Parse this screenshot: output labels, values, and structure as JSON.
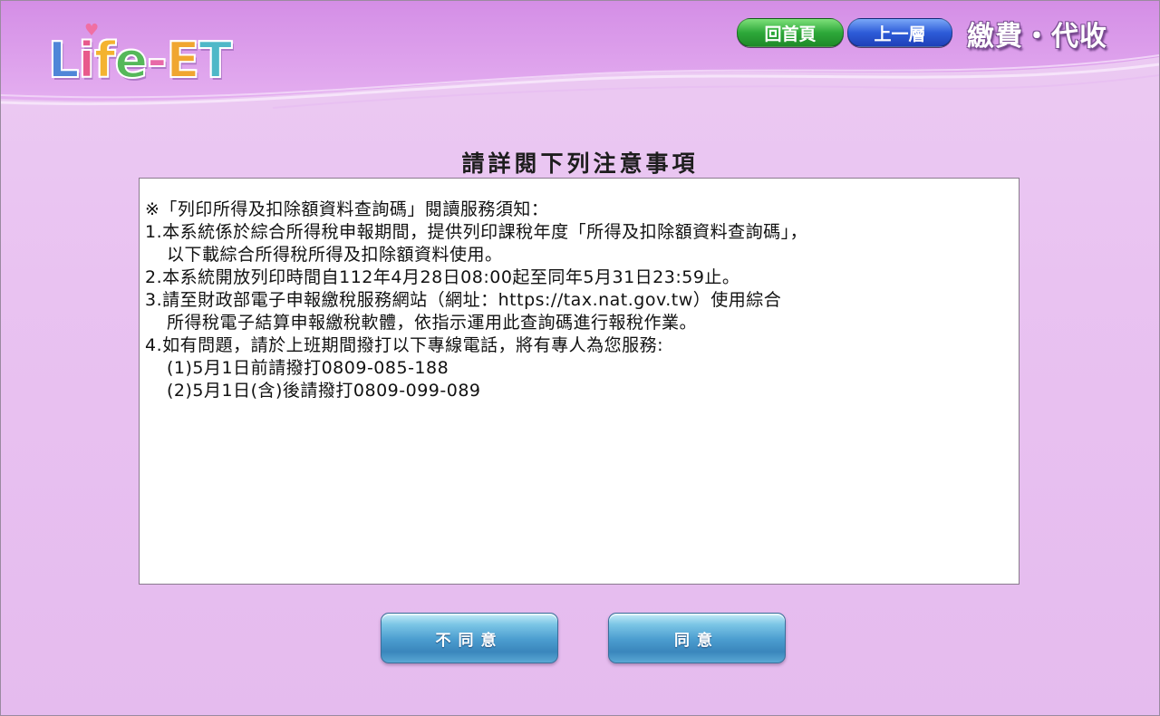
{
  "header": {
    "logo_text": "Life-ET",
    "nav_home_label": "回首頁",
    "nav_up_label": "上一層",
    "section_title": "繳費・代收"
  },
  "main": {
    "heading": "請詳閱下列注意事項",
    "notice_lines": [
      {
        "text": "※「列印所得及扣除額資料查詢碼」閱讀服務須知：",
        "indent": false
      },
      {
        "text": "1.本系統係於綜合所得稅申報期間，提供列印課稅年度「所得及扣除額資料查詢碼」，",
        "indent": false
      },
      {
        "text": "以下載綜合所得稅所得及扣除額資料使用。",
        "indent": true
      },
      {
        "text": "2.本系統開放列印時間自112年4月28日08:00起至同年5月31日23:59止。",
        "indent": false
      },
      {
        "text": "3.請至財政部電子申報繳稅服務網站（網址：https://tax.nat.gov.tw）使用綜合",
        "indent": false
      },
      {
        "text": "所得稅電子結算申報繳稅軟體，依指示運用此查詢碼進行報稅作業。",
        "indent": true
      },
      {
        "text": "4.如有問題，請於上班期間撥打以下專線電話，將有專人為您服務:",
        "indent": false
      },
      {
        "text": "(1)5月1日前請撥打0809-085-188",
        "indent": true
      },
      {
        "text": "(2)5月1日(含)後請撥打0809-099-089",
        "indent": true
      }
    ]
  },
  "actions": {
    "disagree_label": "不同意",
    "agree_label": "同意"
  },
  "colors": {
    "background": "#e9c2f1",
    "nav_home": "#2ea83a",
    "nav_up": "#2e5cd8",
    "action_button": "#4c9ed0"
  }
}
